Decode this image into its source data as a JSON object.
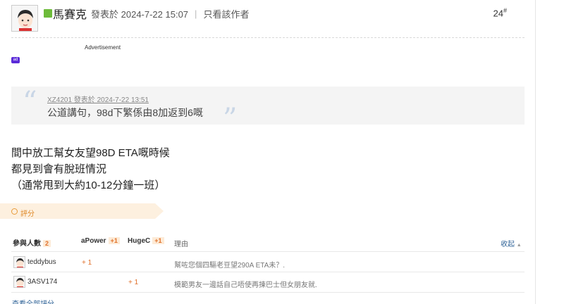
{
  "post": {
    "author": "馬賽克",
    "posted_at": "發表於 2024-7-22 15:07",
    "only_author_link": "只看該作者",
    "floor_number": "24",
    "floor_mark": "#"
  },
  "ad": {
    "label": "Advertisement",
    "icon": "ad-badge-icon"
  },
  "quote": {
    "meta": "XZ4201 發表於 2024-7-22 13:51",
    "text": "公道講句，98d下繁係由8加返到6嘅"
  },
  "body": {
    "lines": [
      "間中放工幫女友望98D ETA嘅時候",
      "都見到會有脫班情況",
      "（通常甩到大約10-12分鐘一班）"
    ]
  },
  "rating": {
    "tab_label": "評分",
    "participants_label": "參與人數",
    "participants_count": "2",
    "columns": [
      {
        "name": "aPower",
        "score": "+1"
      },
      {
        "name": "HugeC",
        "score": "+1"
      }
    ],
    "reason_header": "理由",
    "collapse_label": "收起",
    "rows": [
      {
        "user": "teddybus",
        "apower": "+ 1",
        "hugec": "",
        "reason": "幫咗您個四驅老豆望290A ETA未？."
      },
      {
        "user": "3ASV174",
        "apower": "",
        "hugec": "+ 1",
        "reason": "模範男友一邊話自己唔使再揀巴士但女朋友就."
      }
    ],
    "view_all_label": "查看全部評分"
  },
  "colors": {
    "accent_orange": "#e0702a",
    "link_blue": "#336699",
    "quote_bg": "#f4f4f4"
  }
}
